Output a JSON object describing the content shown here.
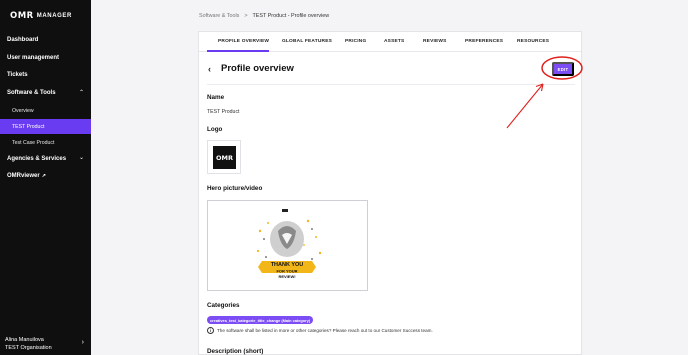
{
  "sidebar": {
    "logo_mark": "OMR",
    "logo_text": "MANAGER",
    "items": [
      {
        "label": "Dashboard"
      },
      {
        "label": "User management"
      },
      {
        "label": "Tickets"
      },
      {
        "label": "Software & Tools"
      },
      {
        "label": "Agencies & Services"
      },
      {
        "label": "OMRviewer"
      }
    ],
    "sub_items": [
      {
        "label": "Overview"
      },
      {
        "label": "TEST Product"
      },
      {
        "label": "Test Case Product"
      }
    ],
    "user": {
      "name": "Alina Manuilova",
      "org": "TEST Organisation"
    }
  },
  "breadcrumb": {
    "parent": "Software & Tools",
    "separator": ">",
    "current": "TEST Product - Profile overview"
  },
  "tabs": [
    {
      "label": "PROFILE OVERVIEW"
    },
    {
      "label": "GLOBAL FEATURES"
    },
    {
      "label": "PRICING"
    },
    {
      "label": "ASSETS"
    },
    {
      "label": "REVIEWS"
    },
    {
      "label": "PREFERENCES"
    },
    {
      "label": "RESOURCES"
    }
  ],
  "page": {
    "title": "Profile overview",
    "edit_label": "EDIT",
    "name_label": "Name",
    "name_value": "TEST Product",
    "logo_label": "Logo",
    "logo_text": "OMR",
    "hero_label": "Hero picture/video",
    "hero_text": [
      "THANK YOU",
      "FOR YOUR",
      "REVIEW!"
    ],
    "categories_label": "Categories",
    "category_badge": "creatives_test_kategorie_title_change (Main category)",
    "info_text": "The software shall be listed in more or other categories? Please reach out to our Customer Success team.",
    "desc_label": "Description (short)"
  },
  "colors": {
    "accent": "#7c4cf5",
    "active_nav": "#6a3cf1",
    "sidebar_bg": "#0f0f10",
    "annotation": "#e0201c"
  }
}
